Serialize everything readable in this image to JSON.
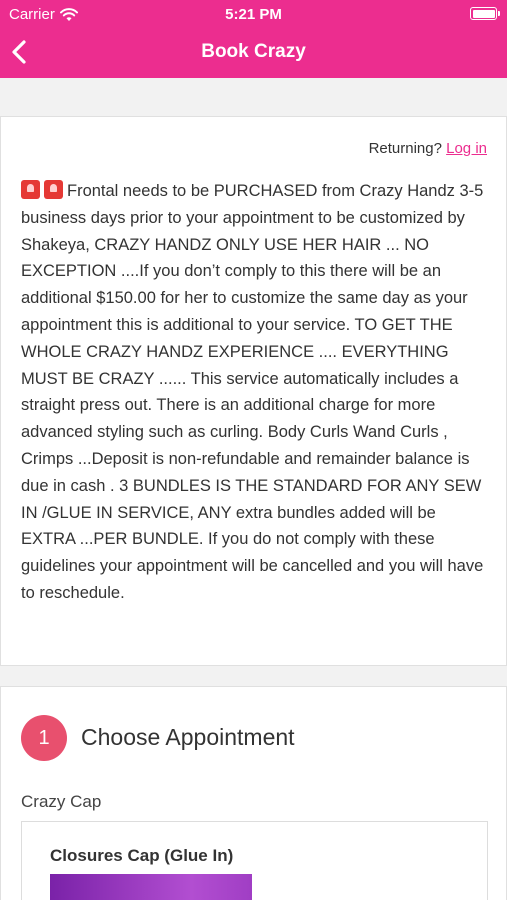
{
  "status_bar": {
    "carrier": "Carrier",
    "time": "5:21 PM"
  },
  "nav": {
    "title": "Book Crazy"
  },
  "info": {
    "returning_text": "Returning?",
    "login_link": "Log in",
    "icons": [
      "siren-icon",
      "siren-icon"
    ],
    "description": "Frontal needs to be PURCHASED from Crazy Handz 3-5 business days prior to your appointment to be customized by Shakeya, CRAZY HANDZ ONLY USE HER HAIR ... NO EXCEPTION ....If you don’t comply to this there will be an additional $150.00 for her to customize the same day as your appointment this is additional to your service. TO GET THE WHOLE CRAZY HANDZ EXPERIENCE .... EVERYTHING MUST BE CRAZY ...... This service automatically includes a straight press out. There is an additional charge for more advanced styling such as curling. Body Curls Wand Curls , Crimps ...Deposit is non-refundable and remainder balance is due in cash . 3 BUNDLES IS THE STANDARD FOR ANY SEW IN /GLUE IN SERVICE, ANY extra bundles added will be EXTRA ...PER BUNDLE. If you do not comply with these guidelines your appointment will be cancelled and you will have to reschedule."
  },
  "booking": {
    "step_number": "1",
    "step_title": "Choose Appointment",
    "category": "Crazy Cap",
    "services": [
      {
        "name": "Closures Cap (Glue In)"
      }
    ]
  },
  "colors": {
    "brand": "#ec2d8f",
    "step_circle": "#e8506e"
  }
}
